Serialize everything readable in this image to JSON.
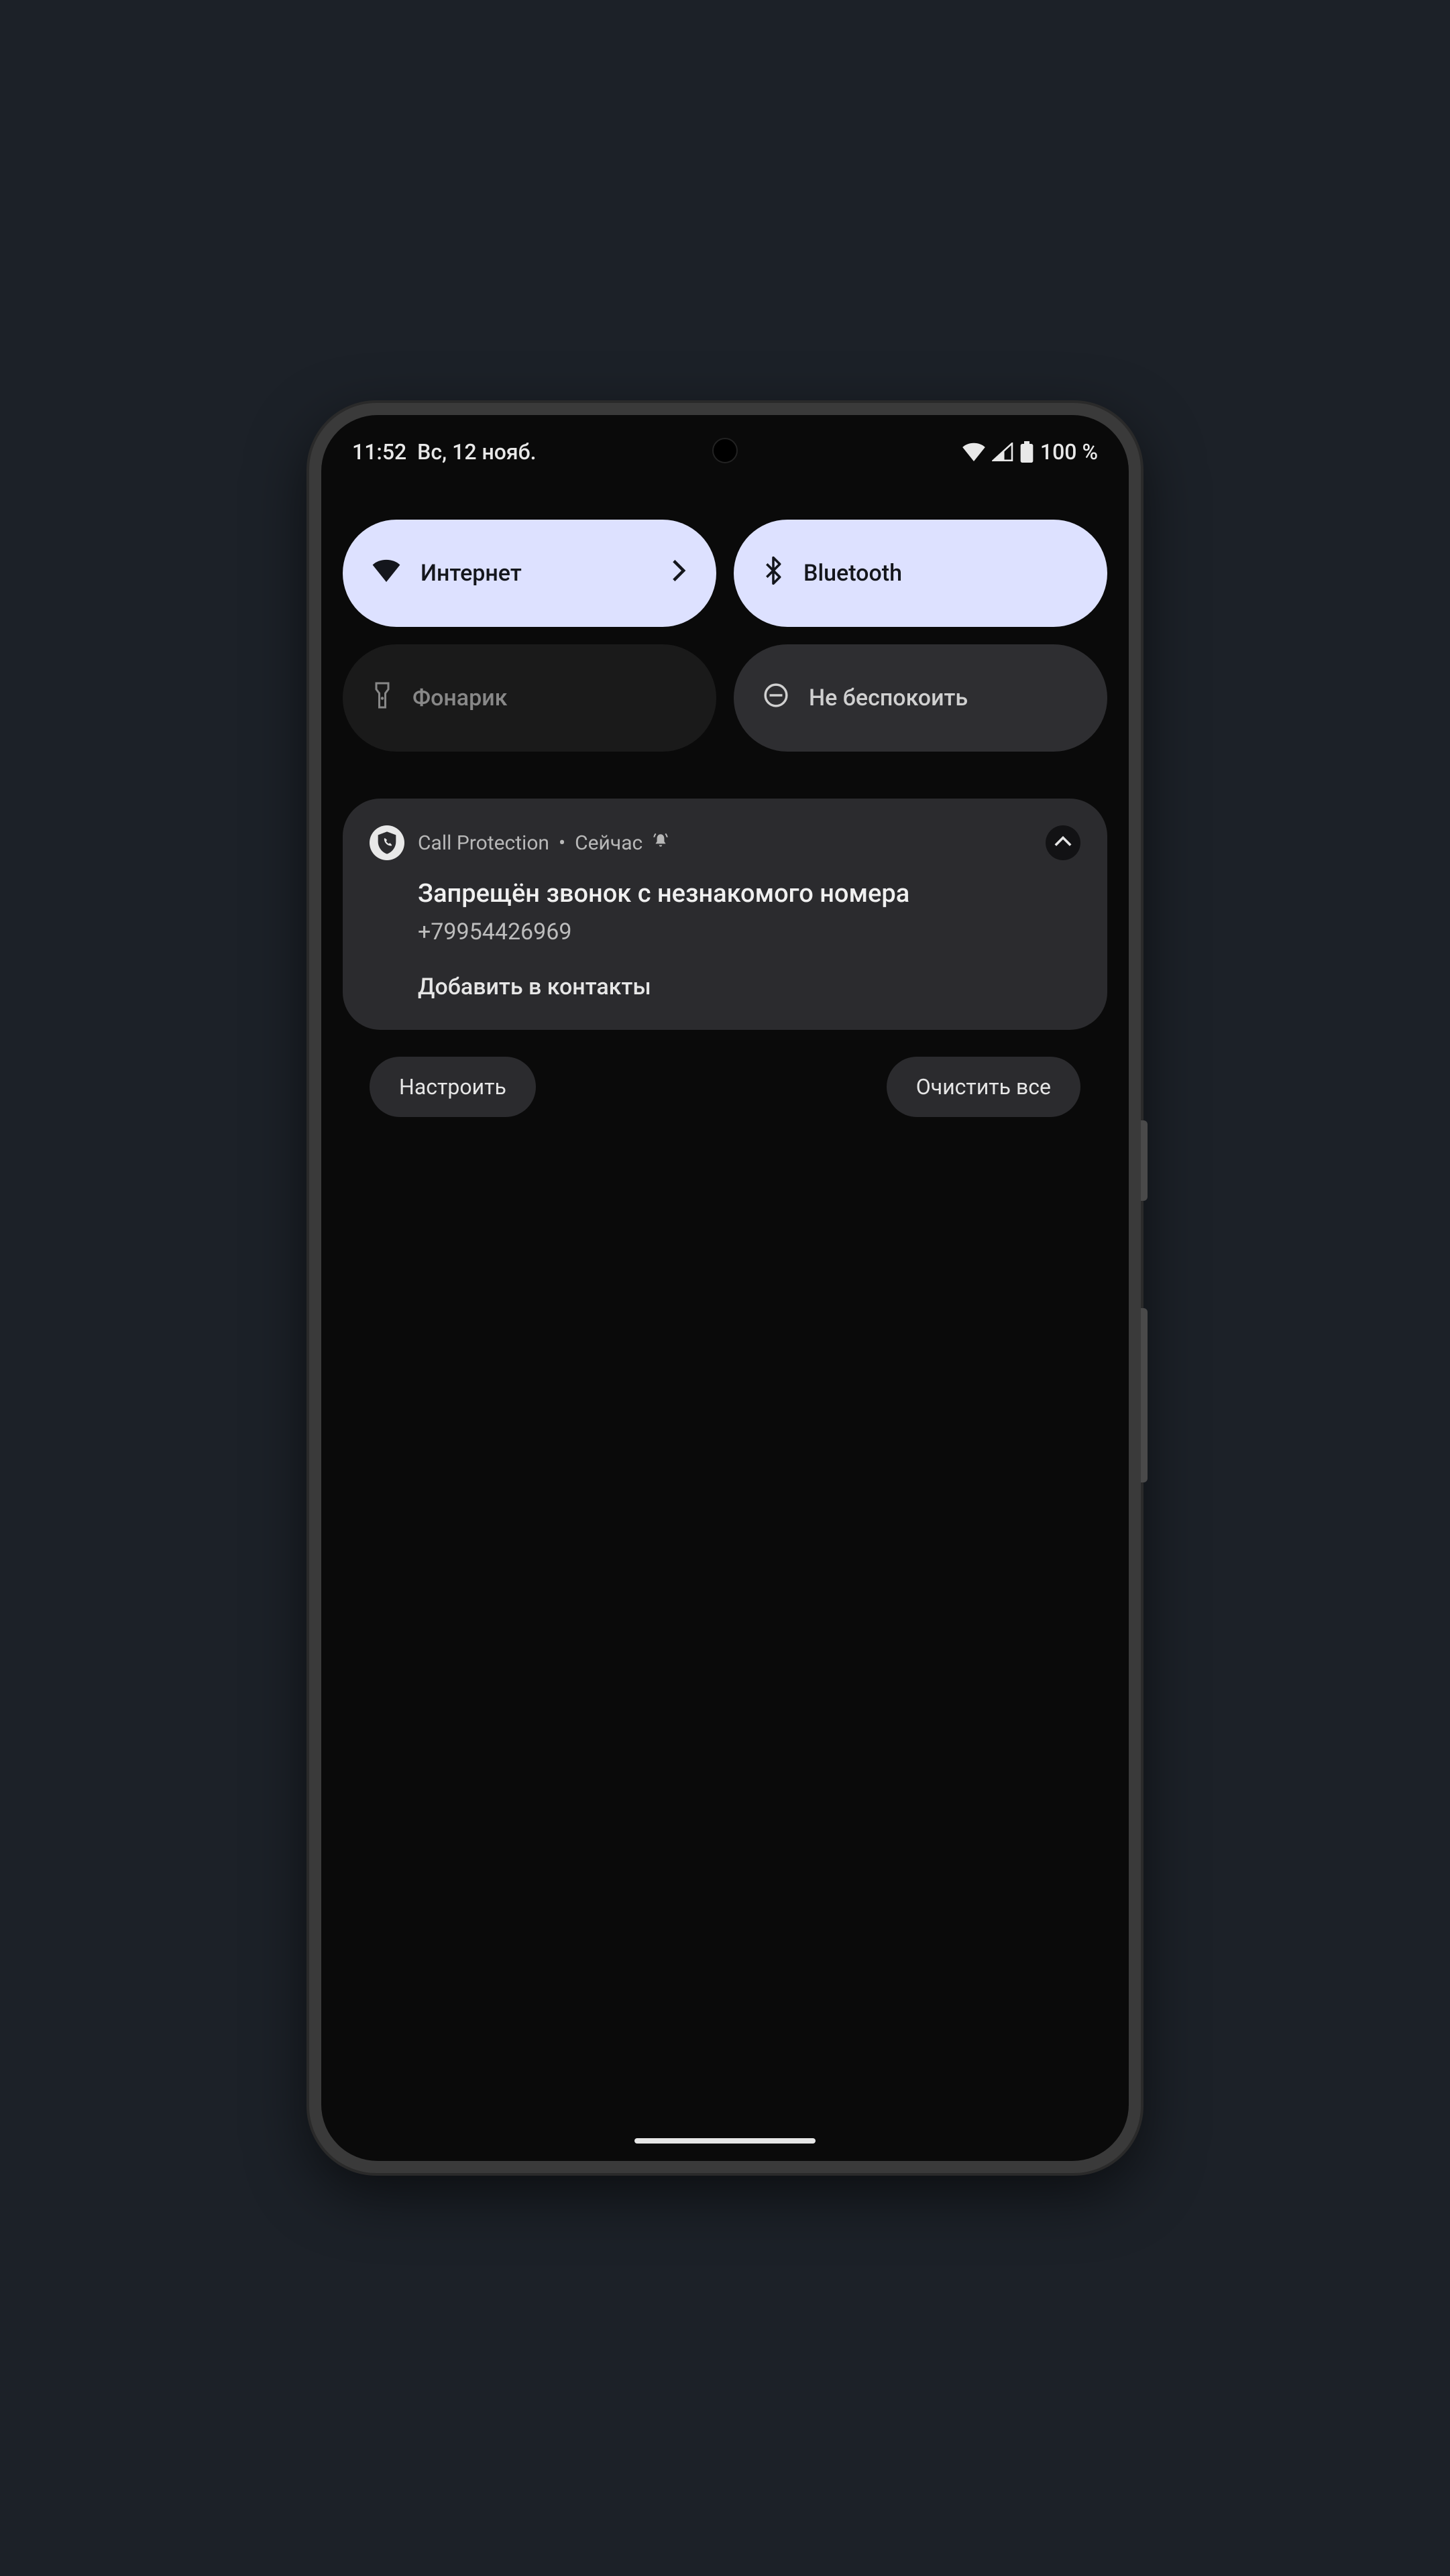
{
  "status": {
    "time": "11:52",
    "date": "Вс, 12 нояб.",
    "battery": "100 %"
  },
  "qs": {
    "internet": "Интернет",
    "bluetooth": "Bluetooth",
    "flashlight": "Фонарик",
    "dnd": "Не беспокоить"
  },
  "notif": {
    "app": "Call Protection",
    "when": "Сейчас",
    "title": "Запрещён звонок с незнакомого номера",
    "number": "+79954426969",
    "action": "Добавить в контакты"
  },
  "footer": {
    "manage": "Настроить",
    "clear": "Очистить все"
  }
}
